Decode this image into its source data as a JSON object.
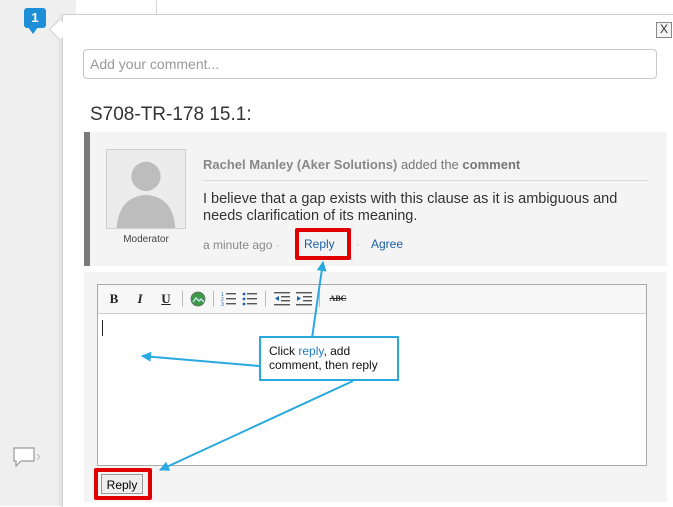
{
  "sidebar": {
    "comment_count": "1"
  },
  "panel": {
    "close_label": "X",
    "add_comment_placeholder": "Add your comment...",
    "issue_title": "S708-TR-178 15.1:"
  },
  "comment": {
    "author": "Rachel Manley (Aker Solutions)",
    "action_text": "added the",
    "target_text": "comment",
    "body": "I believe that a gap exists with this clause as it is ambiguous and needs clarification of its meaning.",
    "timestamp": "a minute ago",
    "reply_label": "Reply",
    "agree_label": "Agree",
    "role": "Moderator",
    "separator": "·"
  },
  "editor": {
    "toolbar": {
      "bold": "B",
      "italic": "I",
      "underline": "U",
      "spellcheck": "ABC"
    },
    "value": "",
    "reply_button_label": "Reply"
  },
  "annotation": {
    "callout_keyword": "reply",
    "callout_pre": "Click ",
    "callout_post": ", add comment, then reply",
    "color_arrow": "#29a9e0",
    "color_highlight": "#e00000"
  }
}
